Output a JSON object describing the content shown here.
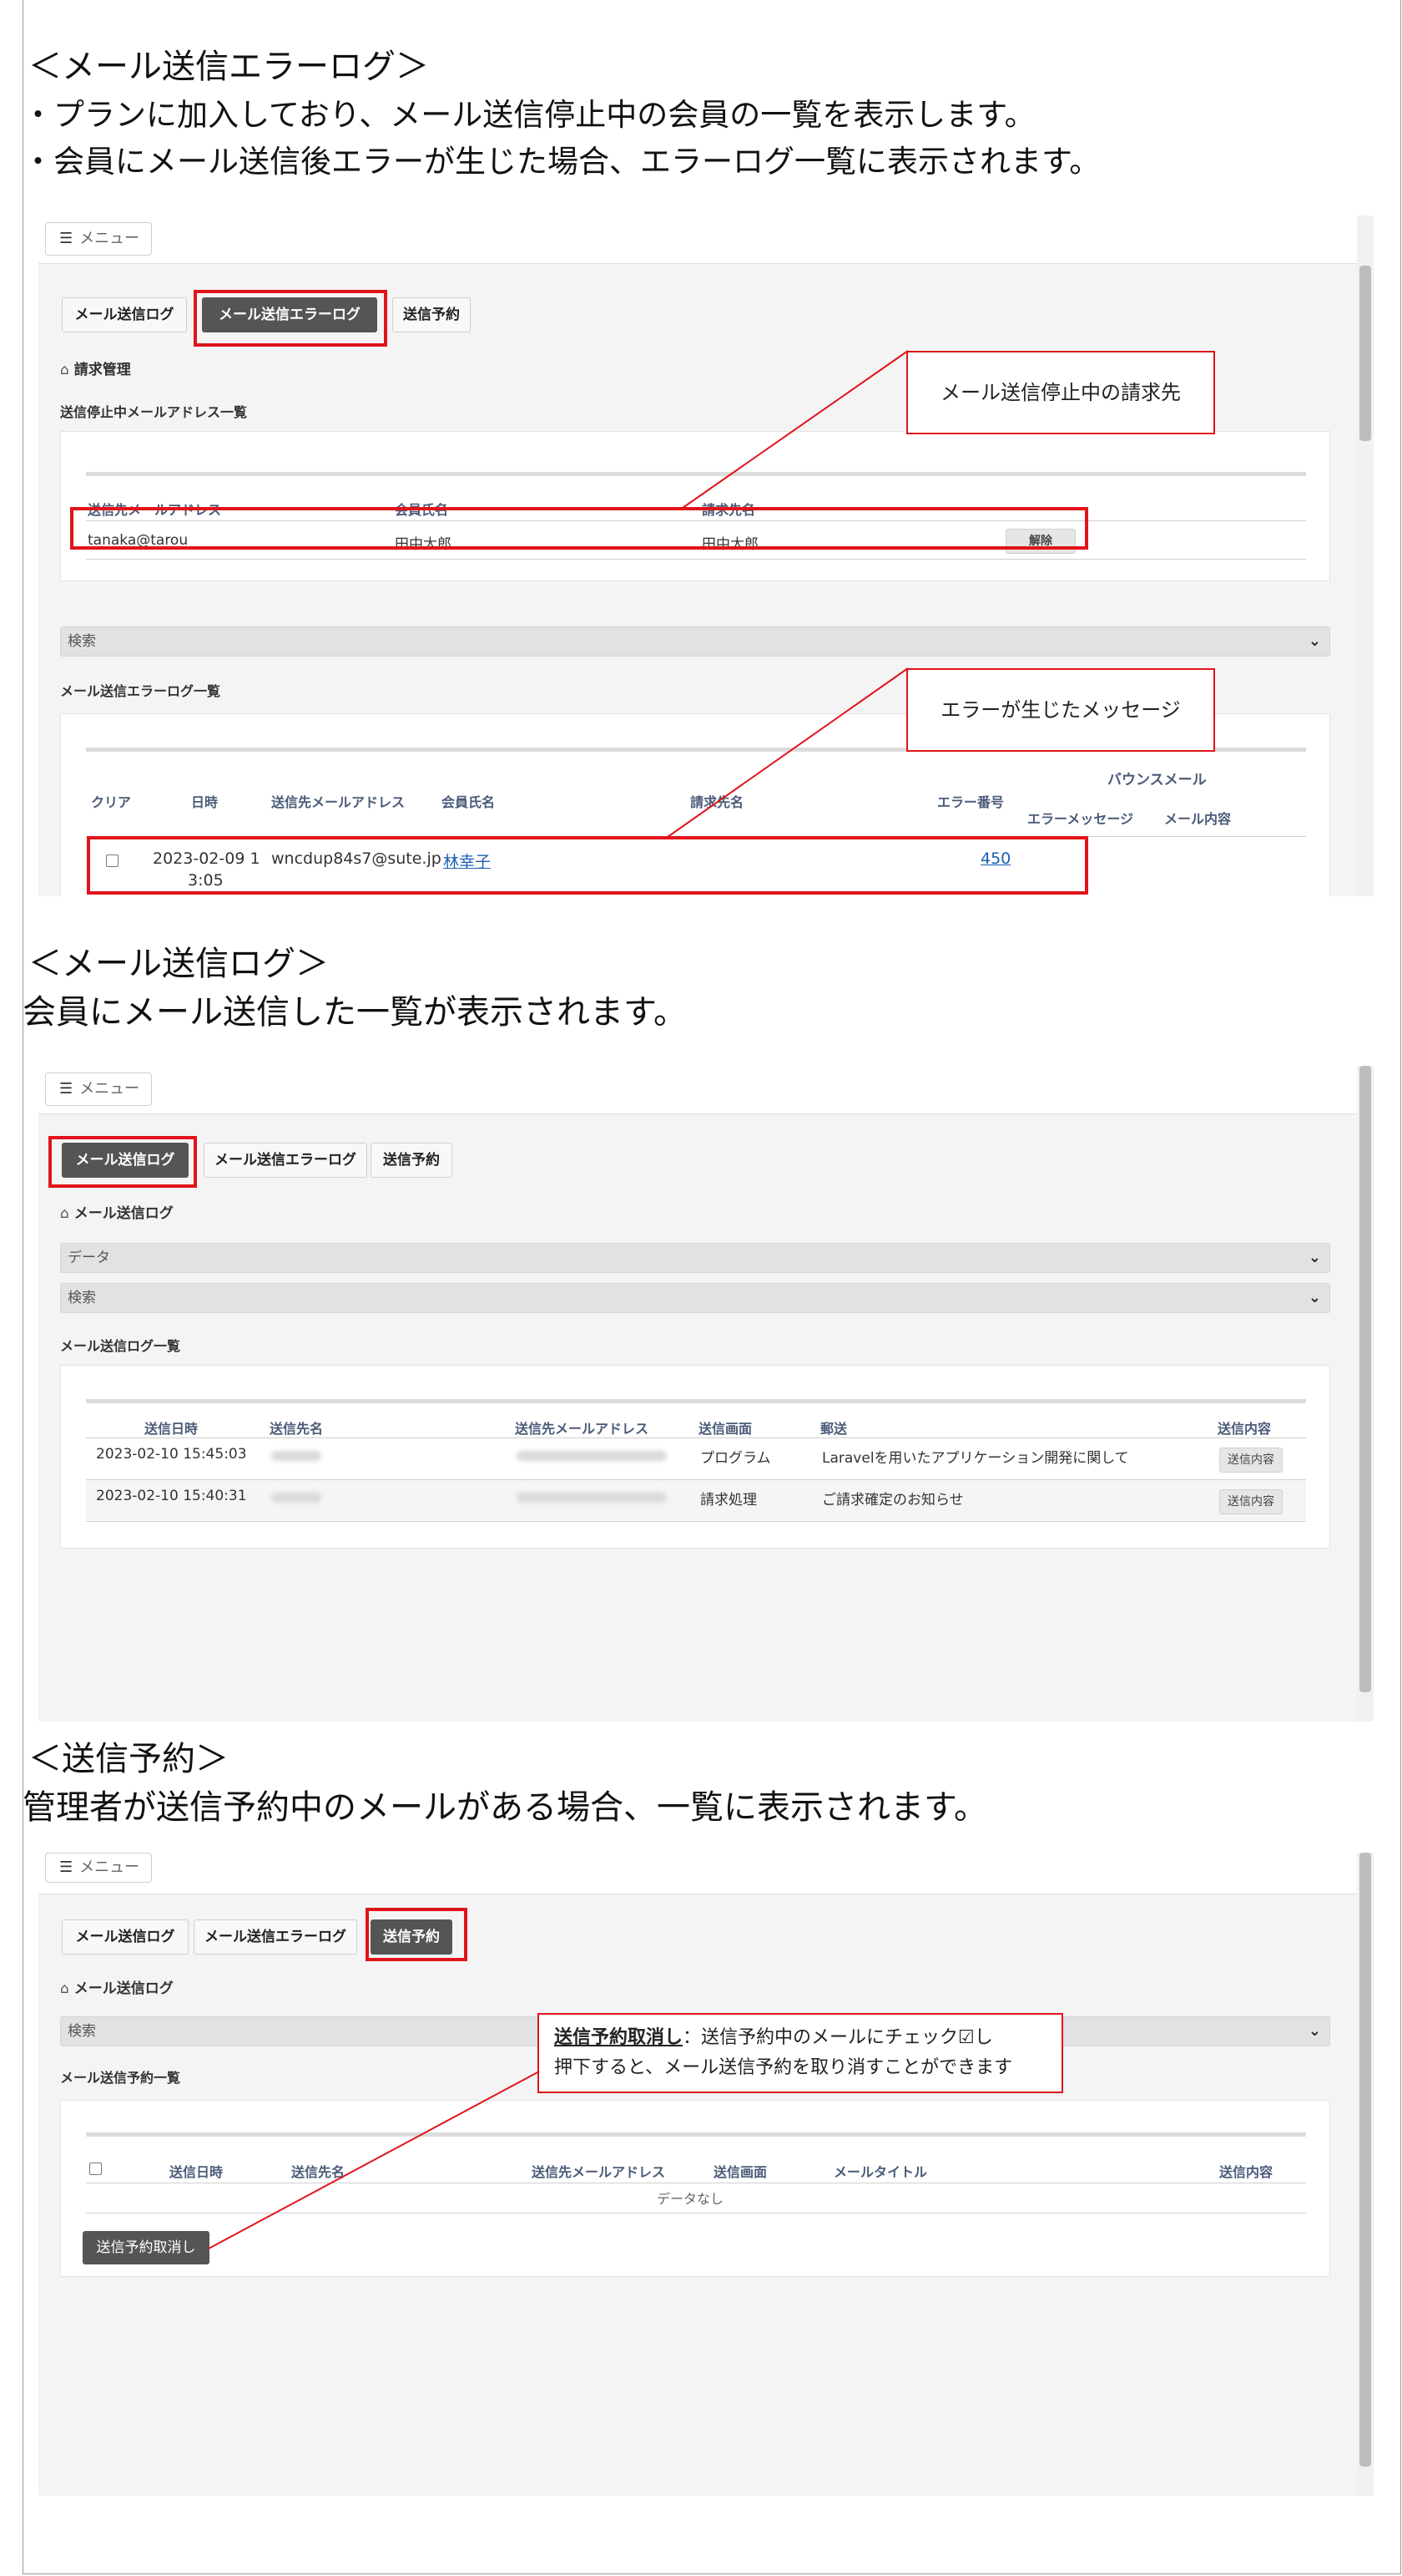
{
  "sections": {
    "error_log": {
      "heading": "＜メール送信エラーログ＞",
      "bullet1": "・プランに加入しており、メール送信停止中の会員の一覧を表示します。",
      "bullet2": "・会員にメール送信後エラーが生じた場合、エラーログ一覧に表示されます。"
    },
    "send_log": {
      "heading": "＜メール送信ログ＞",
      "desc": "会員にメール送信した一覧が表示されます。"
    },
    "reservation": {
      "heading": "＜送信予約＞",
      "desc": "管理者が送信予約中のメールがある場合、一覧に表示されます。"
    }
  },
  "menu_label": "メニュー",
  "tabs": {
    "send_log": "メール送信ログ",
    "error_log": "メール送信エラーログ",
    "reservation": "送信予約"
  },
  "shot1": {
    "section_title": "請求管理",
    "suspended_title": "送信停止中メールアドレス一覧",
    "suspended_headers": [
      "送信先メールアドレス",
      "会員氏名",
      "請求先名"
    ],
    "suspended_row": {
      "email": "tanaka@tarou",
      "member": "田中太郎",
      "billing": "田中太郎",
      "action": "解除"
    },
    "search_label": "検索",
    "errorlog_title": "メール送信エラーログ一覧",
    "errorlog_headers": {
      "clear": "クリア",
      "datetime": "日時",
      "email": "送信先メールアドレス",
      "member": "会員氏名",
      "billing": "請求先名",
      "error_no": "エラー番号",
      "bounce": "バウンスメール",
      "error_msg": "エラーメッセージ",
      "mail_content": "メール内容"
    },
    "errorlog_row": {
      "datetime_line1": "2023-02-09 1",
      "datetime_line2": "3:05",
      "email": "wncdup84s7@sute.jp",
      "member": "林幸子",
      "error_no": "450"
    },
    "callout_billing": "メール送信停止中の請求先",
    "callout_error": "エラーが生じたメッセージ"
  },
  "shot2": {
    "section_title": "メール送信ログ",
    "data_label": "データ",
    "search_label": "検索",
    "list_title": "メール送信ログ一覧",
    "headers": {
      "datetime": "送信日時",
      "to_name": "送信先名",
      "to_email": "送信先メールアドレス",
      "screen": "送信画面",
      "mail": "郵送",
      "content": "送信内容"
    },
    "rows": [
      {
        "datetime": "2023-02-10 15:45:03",
        "screen": "プログラム",
        "subject": "Laravelを用いたアプリケーション開発に関して",
        "button": "送信内容"
      },
      {
        "datetime": "2023-02-10 15:40:31",
        "screen": "請求処理",
        "subject": "ご請求確定のお知らせ",
        "button": "送信内容"
      }
    ]
  },
  "shot3": {
    "section_title": "メール送信ログ",
    "search_label": "検索",
    "list_title": "メール送信予約一覧",
    "headers": {
      "datetime": "送信日時",
      "to_name": "送信先名",
      "to_email": "送信先メールアドレス",
      "screen": "送信画面",
      "title": "メールタイトル",
      "content": "送信内容"
    },
    "empty": "データなし",
    "cancel_button": "送信予約取消し",
    "callout_bold": "送信予約取消し",
    "callout_rest1": "：送信予約中のメールにチェック☑し",
    "callout_line2": "押下すると、メール送信予約を取り消すことができます"
  }
}
